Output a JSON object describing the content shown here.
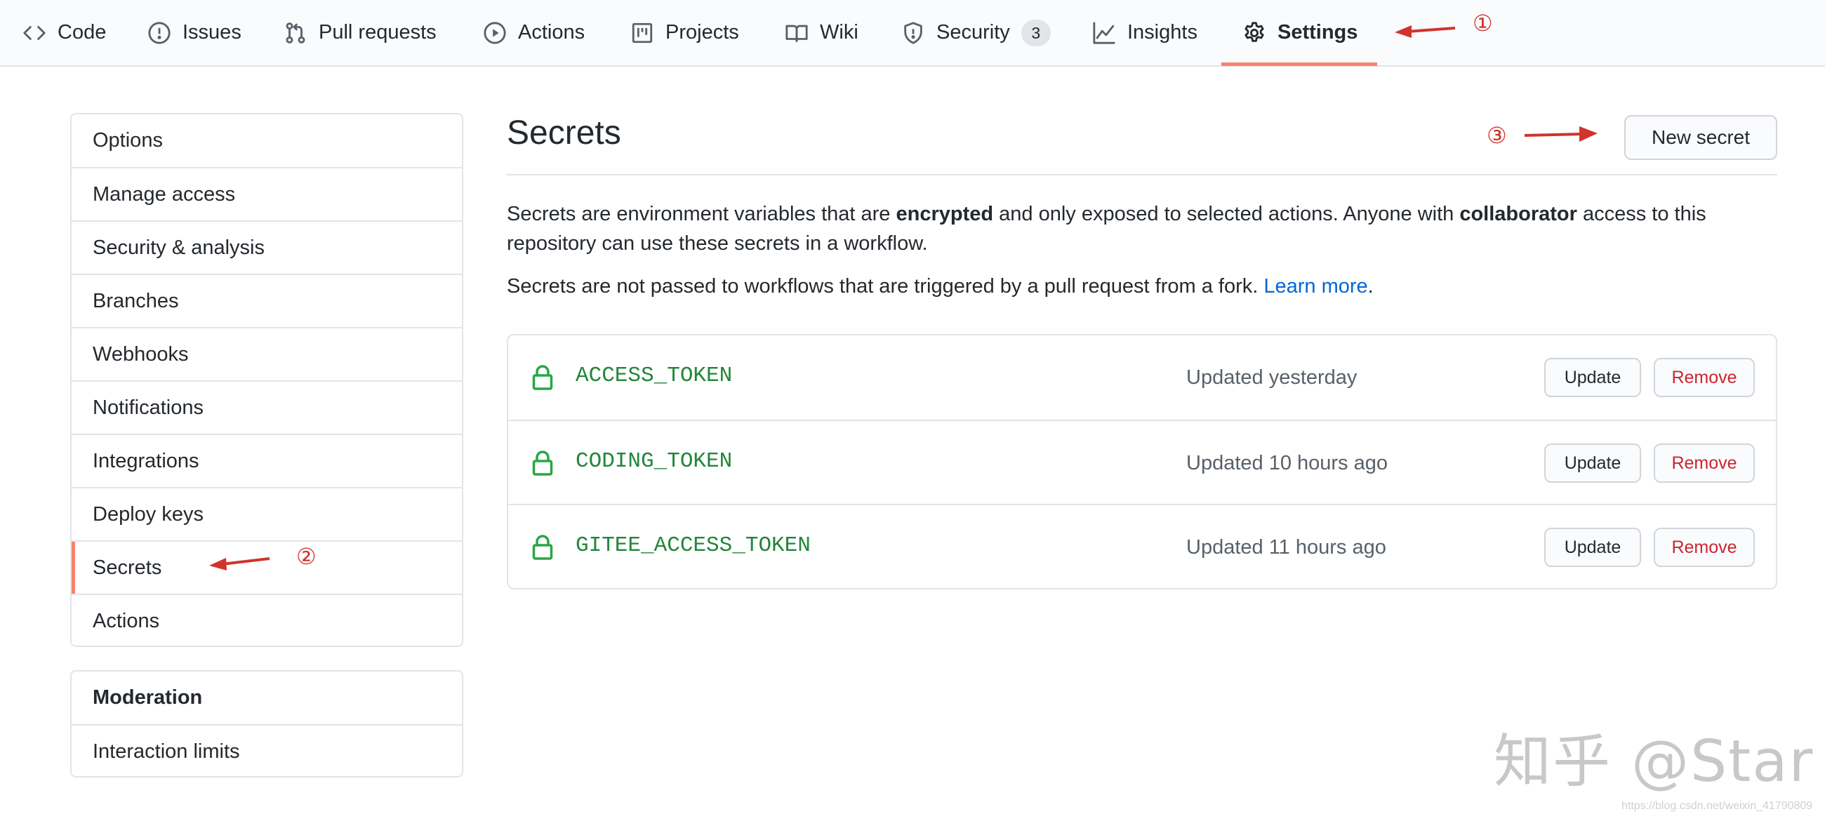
{
  "nav": {
    "tabs": [
      {
        "label": "Code",
        "icon": "code-icon"
      },
      {
        "label": "Issues",
        "icon": "issue-icon"
      },
      {
        "label": "Pull requests",
        "icon": "pull-request-icon"
      },
      {
        "label": "Actions",
        "icon": "play-icon"
      },
      {
        "label": "Projects",
        "icon": "project-icon"
      },
      {
        "label": "Wiki",
        "icon": "book-icon"
      },
      {
        "label": "Security",
        "icon": "shield-icon",
        "count": "3"
      },
      {
        "label": "Insights",
        "icon": "graph-icon"
      },
      {
        "label": "Settings",
        "icon": "gear-icon",
        "selected": true
      }
    ]
  },
  "annotations": [
    "①",
    "②",
    "③"
  ],
  "sidebar": {
    "items": [
      {
        "label": "Options"
      },
      {
        "label": "Manage access"
      },
      {
        "label": "Security & analysis"
      },
      {
        "label": "Branches"
      },
      {
        "label": "Webhooks"
      },
      {
        "label": "Notifications"
      },
      {
        "label": "Integrations"
      },
      {
        "label": "Deploy keys"
      },
      {
        "label": "Secrets",
        "selected": true
      },
      {
        "label": "Actions"
      }
    ],
    "moderation": {
      "heading": "Moderation",
      "items": [
        {
          "label": "Interaction limits"
        }
      ]
    }
  },
  "main": {
    "title": "Secrets",
    "new_button": "New secret",
    "desc1": {
      "a": "Secrets are environment variables that are ",
      "b": "encrypted",
      "c": " and only exposed to selected actions. Anyone with ",
      "d": "collaborator",
      "e": " access to this repository can use these secrets in a workflow."
    },
    "desc2": {
      "text": "Secrets are not passed to workflows that are triggered by a pull request from a fork. ",
      "link": "Learn more",
      "end": "."
    },
    "secrets": [
      {
        "name": "ACCESS_TOKEN",
        "updated": "Updated yesterday"
      },
      {
        "name": "CODING_TOKEN",
        "updated": "Updated 10 hours ago"
      },
      {
        "name": "GITEE_ACCESS_TOKEN",
        "updated": "Updated 11 hours ago"
      }
    ],
    "update_label": "Update",
    "remove_label": "Remove"
  },
  "watermark": "知乎 @Star",
  "source_note": "https://blog.csdn.net/weixin_41790809",
  "colors": {
    "accent": "#f9826c",
    "link": "#0366d6",
    "secret_name": "#22863a",
    "danger": "#cb2431",
    "annotation": "#d0342c"
  }
}
